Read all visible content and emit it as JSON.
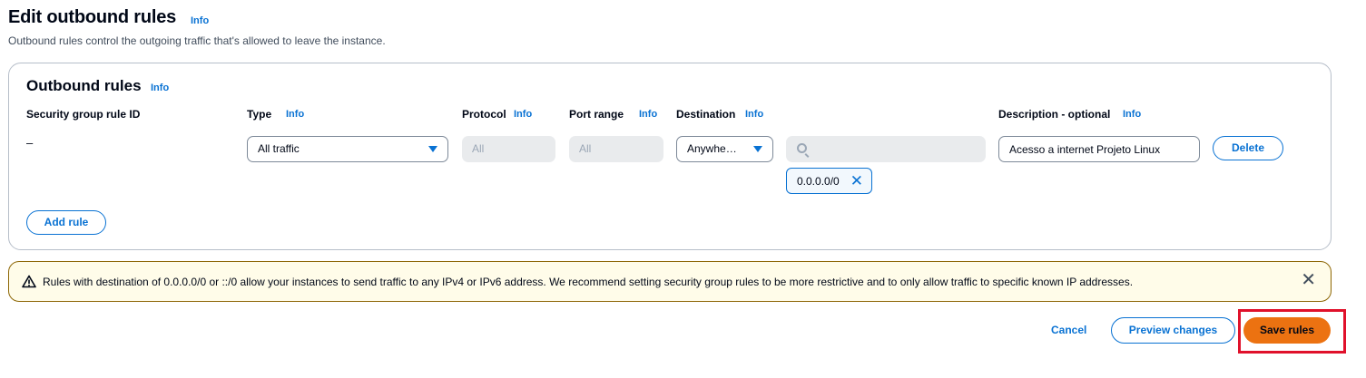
{
  "page": {
    "title": "Edit outbound rules",
    "title_info": "Info",
    "description": "Outbound rules control the outgoing traffic that's allowed to leave the instance."
  },
  "panel": {
    "title": "Outbound rules",
    "title_info": "Info",
    "columns": {
      "rule_id": "Security group rule ID",
      "type": "Type",
      "protocol": "Protocol",
      "port_range": "Port range",
      "destination": "Destination",
      "description": "Description - optional",
      "info": "Info"
    },
    "rule": {
      "rule_id": "–",
      "type": "All traffic",
      "protocol": "All",
      "port_range": "All",
      "destination_type": "Anywhe…",
      "destination_search": "",
      "destination_token": "0.0.0.0/0",
      "description": "Acesso a internet Projeto Linux",
      "delete_label": "Delete"
    },
    "add_rule_label": "Add rule"
  },
  "alert": {
    "text": "Rules with destination of 0.0.0.0/0 or ::/0 allow your instances to send traffic to any IPv4 or IPv6 address. We recommend setting security group rules to be more restrictive and to only allow traffic to specific known IP addresses."
  },
  "footer": {
    "cancel_label": "Cancel",
    "preview_label": "Preview changes",
    "save_label": "Save rules"
  },
  "colors": {
    "accent": "#0972d3",
    "primary_button": "#ec7211",
    "highlight": "#e0112b",
    "warning_bg": "#fffce9"
  }
}
